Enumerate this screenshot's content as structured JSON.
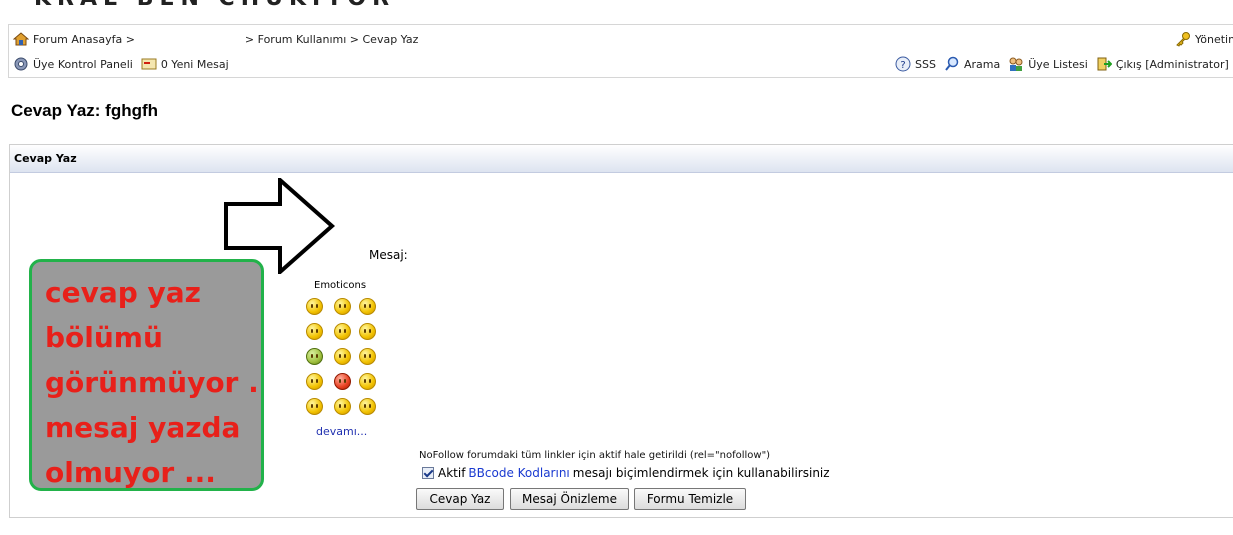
{
  "header": {
    "banner_text": "KRAL  BEN  CHUKIYOR"
  },
  "nav": {
    "row1": {
      "home_link": "Forum Anasayfa >",
      "crumb_rest": "> Forum Kullanımı > Cevap Yaz",
      "admin_link": "Yönetim"
    },
    "row2": {
      "ucp_link": "Üye Kontrol Paneli",
      "messages": "0 Yeni Mesaj",
      "faq": "SSS",
      "search": "Arama",
      "members": "Üye Listesi",
      "logout": "Çıkış [Administrator]"
    }
  },
  "page": {
    "title": "Cevap Yaz: fghgfh"
  },
  "panel": {
    "header": "Cevap Yaz"
  },
  "form": {
    "message_label": "Mesaj:",
    "emoticons_title": "Emoticons",
    "more_link": "devamı...",
    "nofollow_text": "NoFollow forumdaki tüm linkler için aktif hale getirildi (rel=\"nofollow\")",
    "bbcode_prefix": "Aktif",
    "bbcode_link": "BBcode Kodlarını",
    "bbcode_suffix": "mesajı biçimlendirmek için kullanabilirsiniz",
    "bbcode_checked": true,
    "buttons": {
      "submit": "Cevap Yaz",
      "preview": "Mesaj Önizleme",
      "clear": "Formu Temizle"
    }
  },
  "annotation": {
    "lines": [
      "cevap yaz",
      "bölümü",
      "görünmüyor .",
      "mesaj yazda",
      "olmuyor ..."
    ],
    "text_color": "#e8201a",
    "box_color": "#9a9a9a",
    "border_color": "#22b24a"
  }
}
